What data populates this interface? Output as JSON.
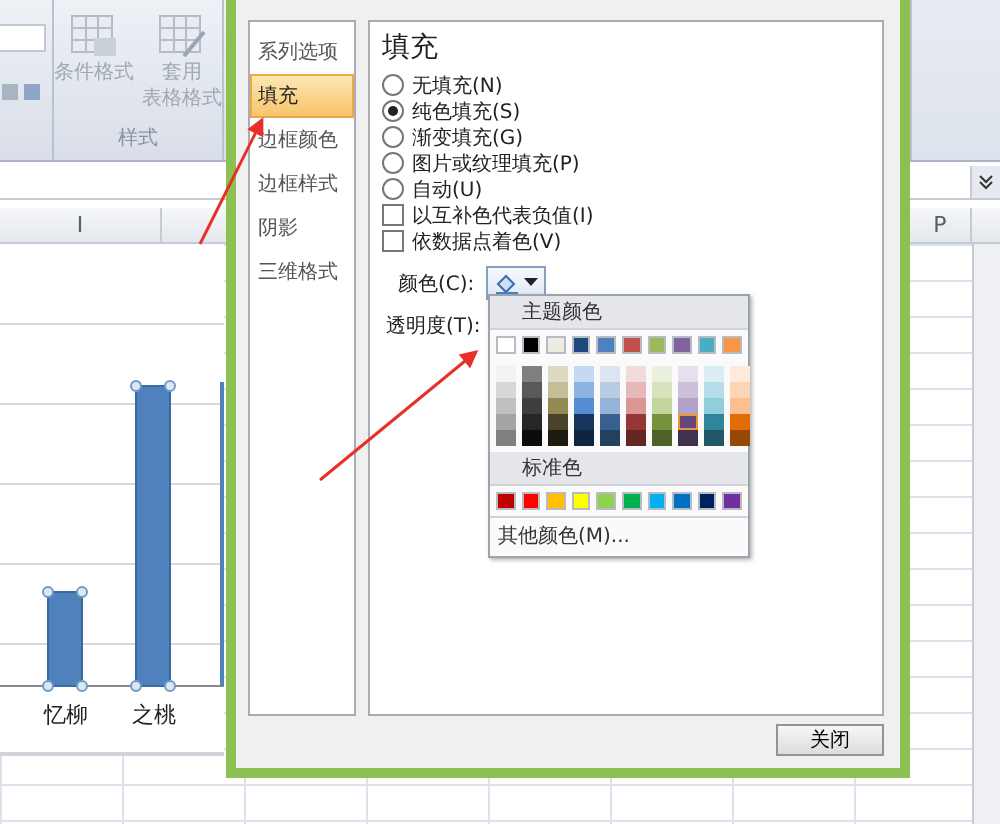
{
  "ribbon": {
    "buttons": [
      {
        "label": "条件格式",
        "kind": "conditional"
      },
      {
        "label": "套用",
        "sub": "表格格式",
        "kind": "table"
      }
    ],
    "group_label": "样式"
  },
  "sheet": {
    "column_headers": [
      {
        "label": "I"
      },
      {
        "label": "P"
      }
    ]
  },
  "chart": {
    "categories": [
      "忆柳",
      "之桃"
    ]
  },
  "dialog": {
    "nav": [
      {
        "label": "系列选项",
        "selected": false
      },
      {
        "label": "填充",
        "selected": true
      },
      {
        "label": "边框颜色",
        "selected": false
      },
      {
        "label": "边框样式",
        "selected": false
      },
      {
        "label": "阴影",
        "selected": false
      },
      {
        "label": "三维格式",
        "selected": false
      }
    ],
    "heading": "填充",
    "fill_options": [
      {
        "label": "无填充(N)",
        "selected": false
      },
      {
        "label": "纯色填充(S)",
        "selected": true
      },
      {
        "label": "渐变填充(G)",
        "selected": false
      },
      {
        "label": "图片或纹理填充(P)",
        "selected": false
      },
      {
        "label": "自动(U)",
        "selected": false
      }
    ],
    "checkboxes": [
      {
        "label": "以互补色代表负值(I)",
        "checked": false
      },
      {
        "label": "依数据点着色(V)",
        "checked": false
      }
    ],
    "color_label": "颜色(C):",
    "transparency_label": "透明度(T):",
    "close_button": "关闭"
  },
  "palette": {
    "theme_title": "主题颜色",
    "theme": [
      {
        "color": "#ffffff",
        "shades": [
          {
            "color": "#f2f2f2",
            "selected": false
          },
          {
            "color": "#d8d8d8",
            "selected": false
          },
          {
            "color": "#bfbfbf",
            "selected": false
          },
          {
            "color": "#a5a5a5",
            "selected": false
          },
          {
            "color": "#7f7f7f",
            "selected": false
          }
        ]
      },
      {
        "color": "#000000",
        "shades": [
          {
            "color": "#7f7f7f",
            "selected": false
          },
          {
            "color": "#595959",
            "selected": false
          },
          {
            "color": "#3f3f3f",
            "selected": false
          },
          {
            "color": "#262626",
            "selected": false
          },
          {
            "color": "#0c0c0c",
            "selected": false
          }
        ]
      },
      {
        "color": "#eeece1",
        "shades": [
          {
            "color": "#ddd9c3",
            "selected": false
          },
          {
            "color": "#c4bd97",
            "selected": false
          },
          {
            "color": "#938953",
            "selected": false
          },
          {
            "color": "#494429",
            "selected": false
          },
          {
            "color": "#1d1b10",
            "selected": false
          }
        ]
      },
      {
        "color": "#1f497d",
        "shades": [
          {
            "color": "#c6d9f0",
            "selected": false
          },
          {
            "color": "#8db3e2",
            "selected": false
          },
          {
            "color": "#548dd4",
            "selected": false
          },
          {
            "color": "#17365d",
            "selected": false
          },
          {
            "color": "#0f243e",
            "selected": false
          }
        ]
      },
      {
        "color": "#4f81bd",
        "shades": [
          {
            "color": "#dbe5f1",
            "selected": false
          },
          {
            "color": "#b8cce4",
            "selected": false
          },
          {
            "color": "#95b3d7",
            "selected": false
          },
          {
            "color": "#366092",
            "selected": false
          },
          {
            "color": "#244061",
            "selected": false
          }
        ]
      },
      {
        "color": "#c0504d",
        "shades": [
          {
            "color": "#f2dcdb",
            "selected": false
          },
          {
            "color": "#e5b9b7",
            "selected": false
          },
          {
            "color": "#d99694",
            "selected": false
          },
          {
            "color": "#953734",
            "selected": false
          },
          {
            "color": "#632423",
            "selected": false
          }
        ]
      },
      {
        "color": "#9bbb59",
        "shades": [
          {
            "color": "#ebf1dd",
            "selected": false
          },
          {
            "color": "#d7e3bc",
            "selected": false
          },
          {
            "color": "#c3d69b",
            "selected": false
          },
          {
            "color": "#76923c",
            "selected": false
          },
          {
            "color": "#4f6128",
            "selected": false
          }
        ]
      },
      {
        "color": "#8064a2",
        "shades": [
          {
            "color": "#e5e0ec",
            "selected": false
          },
          {
            "color": "#ccc1d9",
            "selected": false
          },
          {
            "color": "#b2a2c7",
            "selected": false
          },
          {
            "color": "#5f497a",
            "selected": true
          },
          {
            "color": "#3f3151",
            "selected": false
          }
        ]
      },
      {
        "color": "#4bacc6",
        "shades": [
          {
            "color": "#dbeef3",
            "selected": false
          },
          {
            "color": "#b7dde8",
            "selected": false
          },
          {
            "color": "#92cddc",
            "selected": false
          },
          {
            "color": "#31859b",
            "selected": false
          },
          {
            "color": "#205867",
            "selected": false
          }
        ]
      },
      {
        "color": "#f79646",
        "shades": [
          {
            "color": "#fdeada",
            "selected": false
          },
          {
            "color": "#fbd5b5",
            "selected": false
          },
          {
            "color": "#fac08f",
            "selected": false
          },
          {
            "color": "#e36c09",
            "selected": false
          },
          {
            "color": "#974806",
            "selected": false
          }
        ]
      }
    ],
    "standard_title": "标准色",
    "standard": [
      {
        "color": "#c00000"
      },
      {
        "color": "#ff0000"
      },
      {
        "color": "#ffc000"
      },
      {
        "color": "#ffff00"
      },
      {
        "color": "#92d050"
      },
      {
        "color": "#00b050"
      },
      {
        "color": "#00b0f0"
      },
      {
        "color": "#0070c0"
      },
      {
        "color": "#002060"
      },
      {
        "color": "#7030a0"
      }
    ],
    "more": "其他颜色(M)..."
  }
}
